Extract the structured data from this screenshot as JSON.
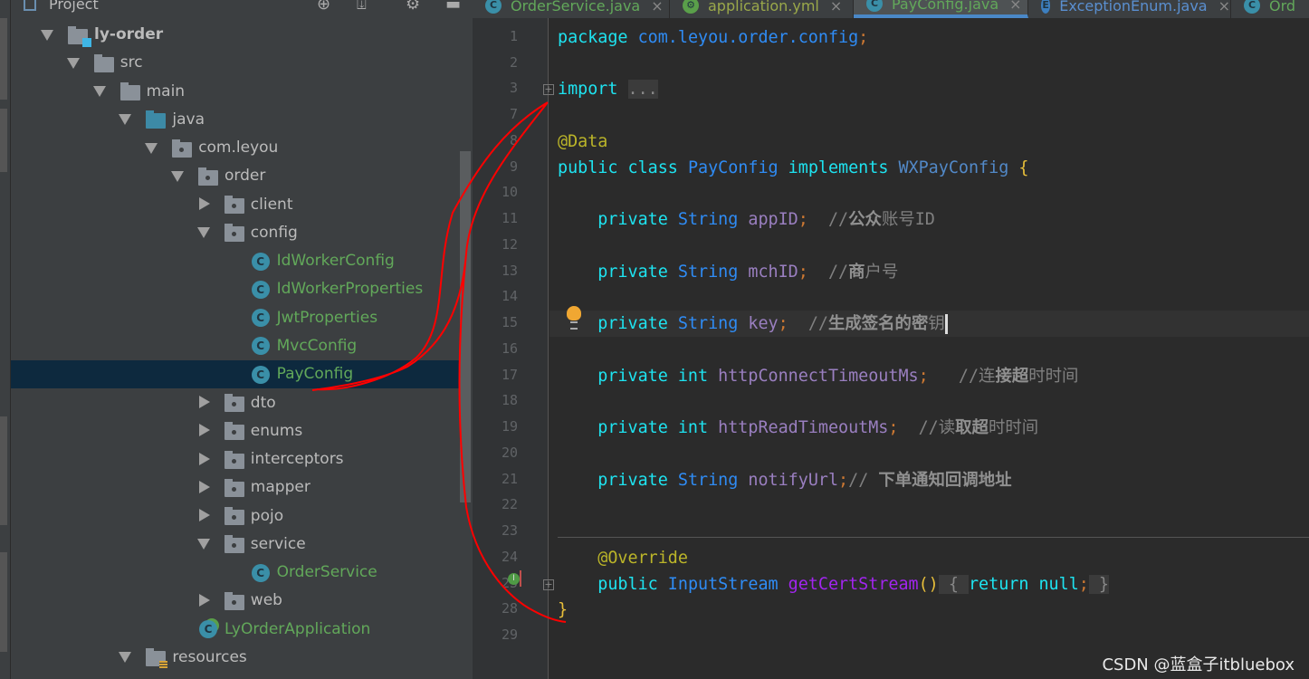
{
  "project_panel": {
    "title": "Project",
    "tree": [
      {
        "label": "ly-order",
        "level": 0,
        "state": "open",
        "icon": "module-folder-icon",
        "bold": true
      },
      {
        "label": "src",
        "level": 1,
        "state": "open",
        "icon": "folder-icon"
      },
      {
        "label": "main",
        "level": 2,
        "state": "open",
        "icon": "folder-icon"
      },
      {
        "label": "java",
        "level": 3,
        "state": "open",
        "icon": "source-folder-icon"
      },
      {
        "label": "com.leyou",
        "level": 4,
        "state": "open",
        "icon": "package-icon"
      },
      {
        "label": "order",
        "level": 5,
        "state": "open",
        "icon": "package-icon"
      },
      {
        "label": "client",
        "level": 6,
        "state": "closed",
        "icon": "package-icon"
      },
      {
        "label": "config",
        "level": 6,
        "state": "open",
        "icon": "package-icon"
      },
      {
        "label": "IdWorkerConfig",
        "level": 7,
        "state": "none",
        "icon": "class-icon",
        "green": true
      },
      {
        "label": "IdWorkerProperties",
        "level": 7,
        "state": "none",
        "icon": "class-icon",
        "green": true
      },
      {
        "label": "JwtProperties",
        "level": 7,
        "state": "none",
        "icon": "class-icon",
        "green": true
      },
      {
        "label": "MvcConfig",
        "level": 7,
        "state": "none",
        "icon": "class-icon",
        "green": true
      },
      {
        "label": "PayConfig",
        "level": 7,
        "state": "none",
        "icon": "class-icon",
        "green": true,
        "selected": true
      },
      {
        "label": "dto",
        "level": 6,
        "state": "closed",
        "icon": "package-icon"
      },
      {
        "label": "enums",
        "level": 6,
        "state": "closed",
        "icon": "package-icon"
      },
      {
        "label": "interceptors",
        "level": 6,
        "state": "closed",
        "icon": "package-icon"
      },
      {
        "label": "mapper",
        "level": 6,
        "state": "closed",
        "icon": "package-icon"
      },
      {
        "label": "pojo",
        "level": 6,
        "state": "closed",
        "icon": "package-icon"
      },
      {
        "label": "service",
        "level": 6,
        "state": "open",
        "icon": "package-icon"
      },
      {
        "label": "OrderService",
        "level": 7,
        "state": "none",
        "icon": "class-icon",
        "green": true
      },
      {
        "label": "web",
        "level": 6,
        "state": "closed",
        "icon": "package-icon"
      },
      {
        "label": "LyOrderApplication",
        "level": 5,
        "state": "none",
        "icon": "spring-app-icon",
        "green": true
      },
      {
        "label": "resources",
        "level": 3,
        "state": "open",
        "icon": "resources-folder-icon"
      }
    ]
  },
  "tabs": [
    {
      "label": "OrderService.java",
      "icon": "C"
    },
    {
      "label": "application.yml",
      "icon": "gear"
    },
    {
      "label": "PayConfig.java",
      "icon": "C",
      "active": true
    },
    {
      "label": "ExceptionEnum.java",
      "icon": "E"
    },
    {
      "label": "Ord",
      "icon": "C"
    }
  ],
  "editor": {
    "current_line": "15",
    "lines": [
      {
        "n": "1",
        "t": [
          [
            "kw",
            "package "
          ],
          [
            "ty",
            "com.leyou.order.config"
          ],
          [
            "sc",
            ";"
          ]
        ]
      },
      {
        "n": "2",
        "t": []
      },
      {
        "n": "3",
        "fold": true,
        "t": [
          [
            "kw",
            "import "
          ],
          [
            "fold",
            "..."
          ]
        ]
      },
      {
        "n": "7",
        "t": []
      },
      {
        "n": "8",
        "t": [
          [
            "an",
            "@Data"
          ]
        ]
      },
      {
        "n": "9",
        "t": [
          [
            "kw",
            "public class "
          ],
          [
            "ty",
            "PayConfig "
          ],
          [
            "kw",
            "implements "
          ],
          [
            "ty2",
            "WXPayConfig "
          ],
          [
            "br",
            "{"
          ]
        ]
      },
      {
        "n": "10",
        "t": []
      },
      {
        "n": "11",
        "t": [
          [
            "kw",
            "    private "
          ],
          [
            "ty",
            "String "
          ],
          [
            "fd",
            "appID"
          ],
          [
            "sc",
            ";"
          ],
          [
            "cm",
            "  //"
          ],
          [
            "cmb",
            "公众"
          ],
          [
            "cm",
            "账号ID"
          ]
        ]
      },
      {
        "n": "12",
        "t": []
      },
      {
        "n": "13",
        "t": [
          [
            "kw",
            "    private "
          ],
          [
            "ty",
            "String "
          ],
          [
            "fd",
            "mchID"
          ],
          [
            "sc",
            ";"
          ],
          [
            "cm",
            "  //"
          ],
          [
            "cmb",
            "商"
          ],
          [
            "cm",
            "户号"
          ]
        ]
      },
      {
        "n": "14",
        "t": []
      },
      {
        "n": "15",
        "t": [
          [
            "kw",
            "    private "
          ],
          [
            "ty",
            "String "
          ],
          [
            "fd",
            "key"
          ],
          [
            "sc",
            ";"
          ],
          [
            "cm",
            "  //"
          ],
          [
            "cmb",
            "生成签名的密"
          ],
          [
            "cm",
            "钥"
          ]
        ]
      },
      {
        "n": "16",
        "t": []
      },
      {
        "n": "17",
        "t": [
          [
            "kw",
            "    private int "
          ],
          [
            "fd",
            "httpConnectTimeoutMs"
          ],
          [
            "sc",
            ";"
          ],
          [
            "cm",
            "   //连"
          ],
          [
            "cmb",
            "接超"
          ],
          [
            "cm",
            "时时间"
          ]
        ]
      },
      {
        "n": "18",
        "t": []
      },
      {
        "n": "19",
        "t": [
          [
            "kw",
            "    private int "
          ],
          [
            "fd",
            "httpReadTimeoutMs"
          ],
          [
            "sc",
            ";"
          ],
          [
            "cm",
            "  //读"
          ],
          [
            "cmb",
            "取超"
          ],
          [
            "cm",
            "时时间"
          ]
        ]
      },
      {
        "n": "20",
        "t": []
      },
      {
        "n": "21",
        "t": [
          [
            "kw",
            "    private "
          ],
          [
            "ty",
            "String "
          ],
          [
            "fd",
            "notifyUrl"
          ],
          [
            "sc",
            ";"
          ],
          [
            "cm",
            "// "
          ],
          [
            "cmb",
            "下单通知回调地址"
          ]
        ]
      },
      {
        "n": "22",
        "t": []
      },
      {
        "n": "23",
        "t": []
      },
      {
        "n": "24",
        "t": [
          [
            "an",
            "    @Override"
          ]
        ]
      },
      {
        "n": "25",
        "fold": true,
        "t": [
          [
            "kw",
            "    public "
          ],
          [
            "ty",
            "InputStream "
          ],
          [
            "mt",
            "getCertStream"
          ],
          [
            "br",
            "()"
          ],
          [
            "fold",
            " { "
          ],
          [
            "kw",
            "return null"
          ],
          [
            "sc",
            ";"
          ],
          [
            "fold",
            " }"
          ]
        ]
      },
      {
        "n": "28",
        "t": [
          [
            "br",
            "}"
          ]
        ]
      },
      {
        "n": "29",
        "t": []
      }
    ]
  },
  "watermark": "CSDN @蓝盒子itbluebox",
  "colors": {
    "annotation_stroke": "#ff0000",
    "selection": "#0d293e",
    "editor_bg": "#2b2b2b"
  }
}
